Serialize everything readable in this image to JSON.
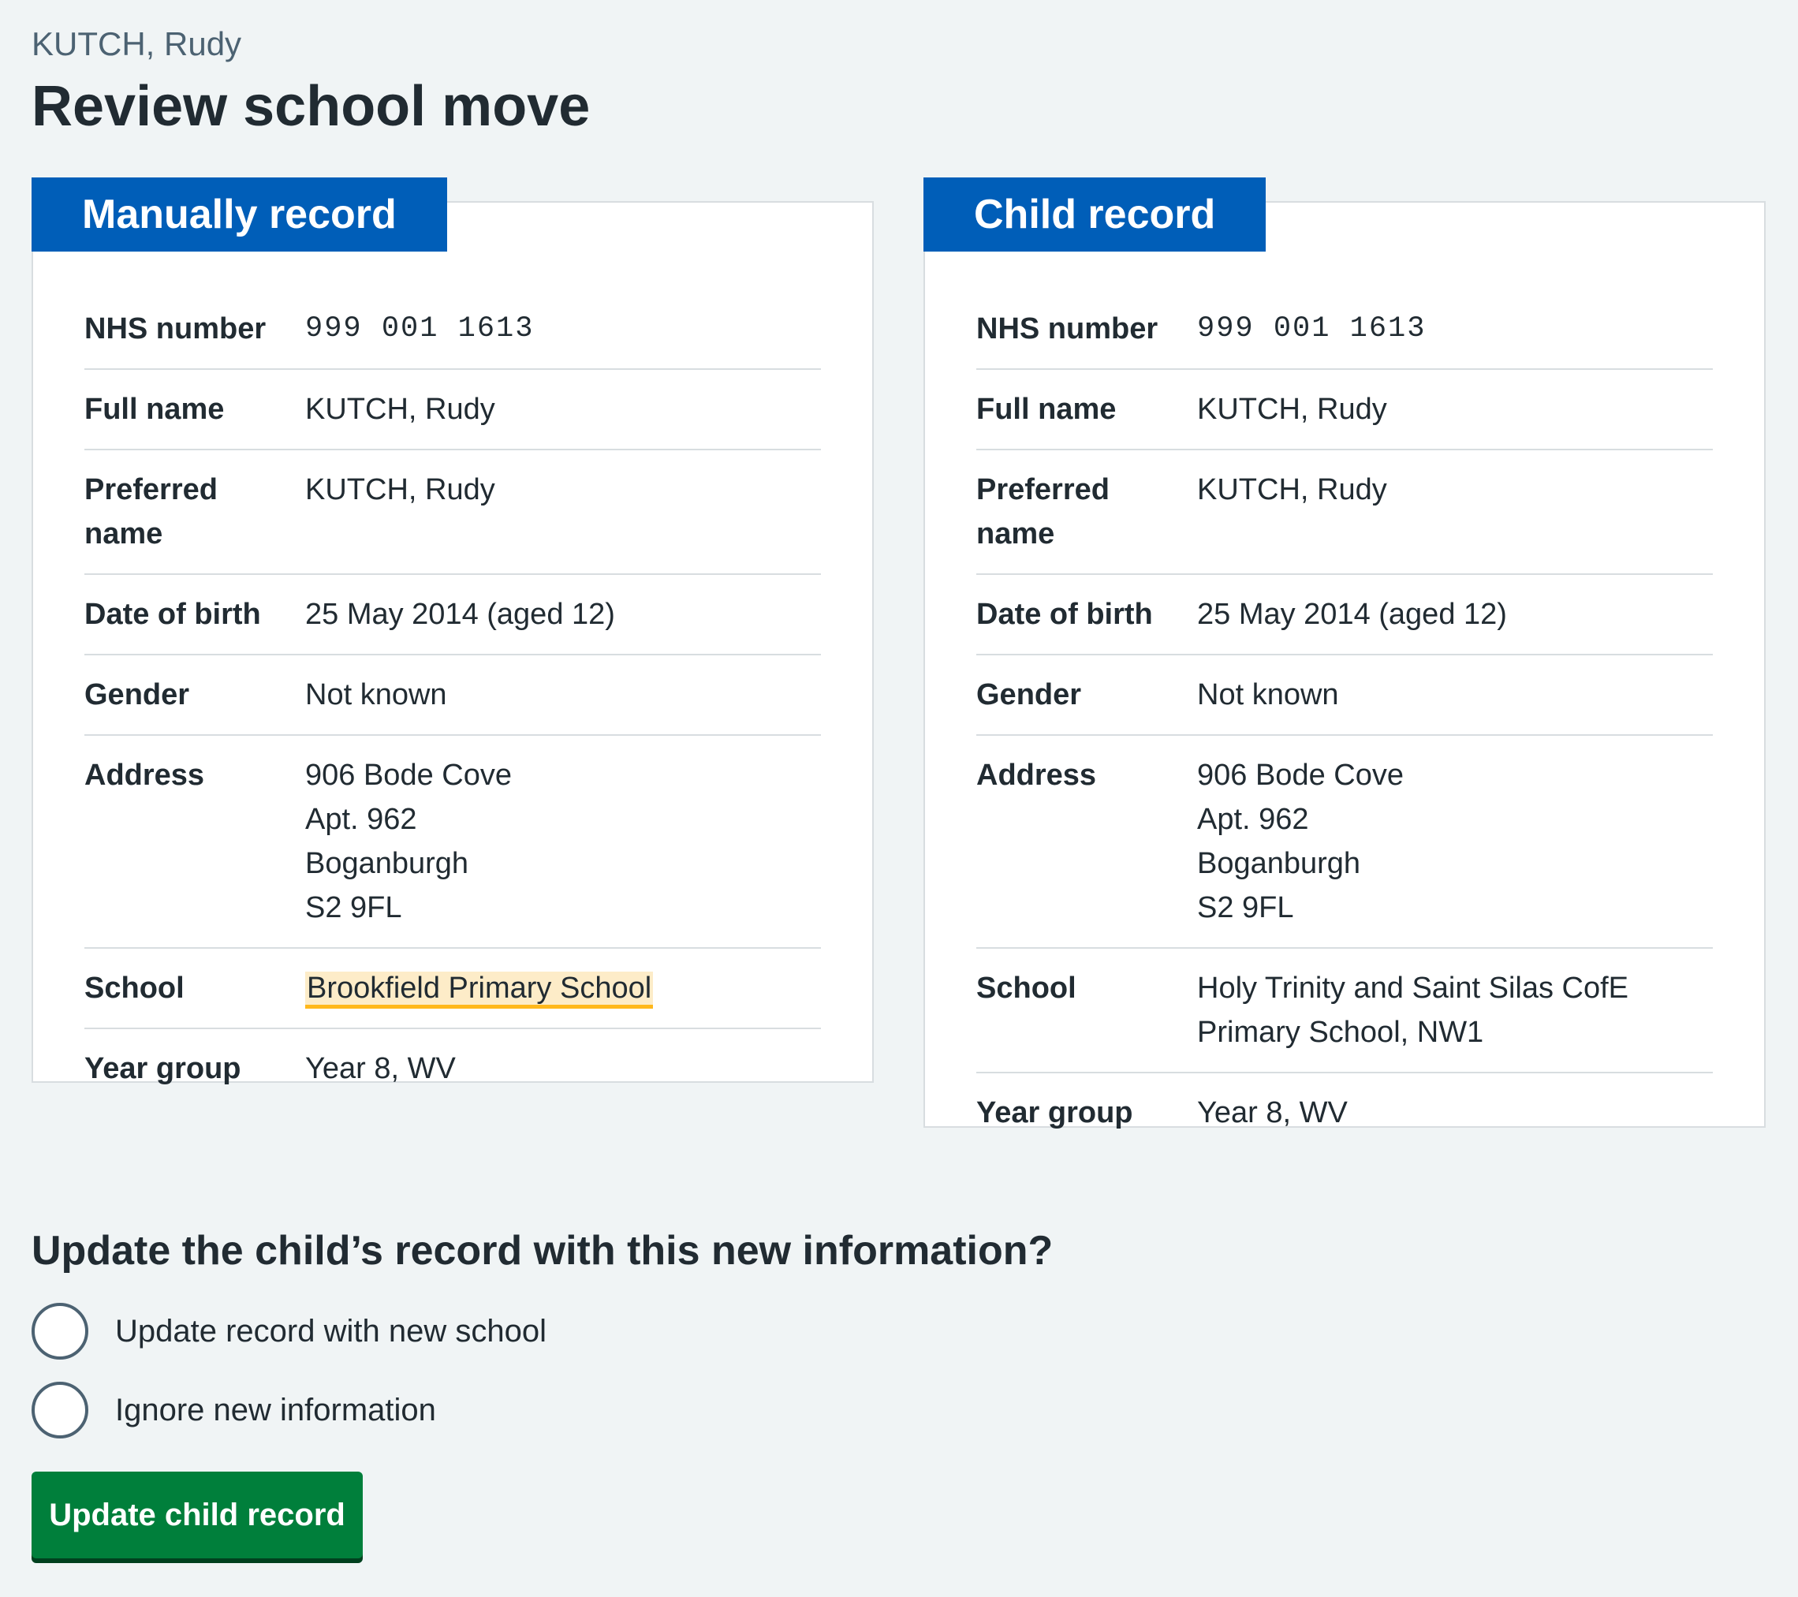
{
  "caption": "KUTCH, Rudy",
  "title": "Review school move",
  "cards": {
    "left": {
      "heading": "Manually record",
      "rows": {
        "nhs": {
          "key": "NHS number",
          "value": "999 001 1613"
        },
        "full_name": {
          "key": "Full name",
          "value": "KUTCH, Rudy"
        },
        "preferred_name": {
          "key": "Preferred name",
          "value": "KUTCH, Rudy"
        },
        "dob": {
          "key": "Date of birth",
          "value": "25 May 2014 (aged 12)"
        },
        "gender": {
          "key": "Gender",
          "value": "Not known"
        },
        "address": {
          "key": "Address",
          "lines": [
            "906 Bode Cove",
            "Apt. 962",
            "Boganburgh",
            "S2 9FL"
          ]
        },
        "school": {
          "key": "School",
          "value": "Brookfield Primary School"
        },
        "year_group": {
          "key": "Year group",
          "value": "Year 8, WV"
        }
      }
    },
    "right": {
      "heading": "Child record",
      "rows": {
        "nhs": {
          "key": "NHS number",
          "value": "999 001 1613"
        },
        "full_name": {
          "key": "Full name",
          "value": "KUTCH, Rudy"
        },
        "preferred_name": {
          "key": "Preferred name",
          "value": "KUTCH, Rudy"
        },
        "dob": {
          "key": "Date of birth",
          "value": "25 May 2014 (aged 12)"
        },
        "gender": {
          "key": "Gender",
          "value": "Not known"
        },
        "address": {
          "key": "Address",
          "lines": [
            "906 Bode Cove",
            "Apt. 962",
            "Boganburgh",
            "S2 9FL"
          ]
        },
        "school": {
          "key": "School",
          "value": "Holy Trinity and Saint Silas CofE Primary School, NW1"
        },
        "year_group": {
          "key": "Year group",
          "value": "Year 8, WV"
        }
      }
    }
  },
  "question": "Update the child’s record with this new information?",
  "options": [
    {
      "label": "Update record with new school"
    },
    {
      "label": "Ignore new information"
    }
  ],
  "submit_label": "Update child record",
  "colors": {
    "brand_blue": "#005eb8",
    "button_green": "#007f3b",
    "highlight_bg": "#fdecc8",
    "highlight_border": "#ffb81c",
    "background": "#f0f4f5"
  }
}
